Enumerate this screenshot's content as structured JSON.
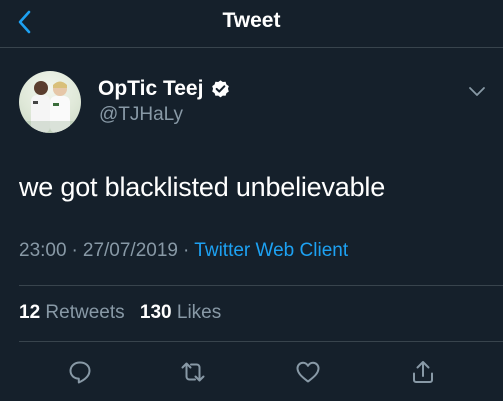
{
  "header": {
    "title": "Tweet",
    "back_icon": "chevron-left-icon",
    "accent_color": "#1da1f2"
  },
  "author": {
    "display_name": "OpTic Teej",
    "handle": "@TJHaLy",
    "verified": true,
    "verified_icon": "verified-badge-icon"
  },
  "tweet": {
    "text": "we got blacklisted unbelievable",
    "time": "23:00",
    "date": "27/07/2019",
    "separator": "·",
    "source": "Twitter Web Client"
  },
  "stats": {
    "retweets_count": "12",
    "retweets_label": "Retweets",
    "likes_count": "130",
    "likes_label": "Likes"
  },
  "actions": [
    "reply-icon",
    "retweet-icon",
    "like-icon",
    "share-icon"
  ],
  "colors": {
    "background": "#15202b",
    "secondary_text": "#8899a6",
    "divider": "#38444d",
    "link": "#1da1f2"
  }
}
